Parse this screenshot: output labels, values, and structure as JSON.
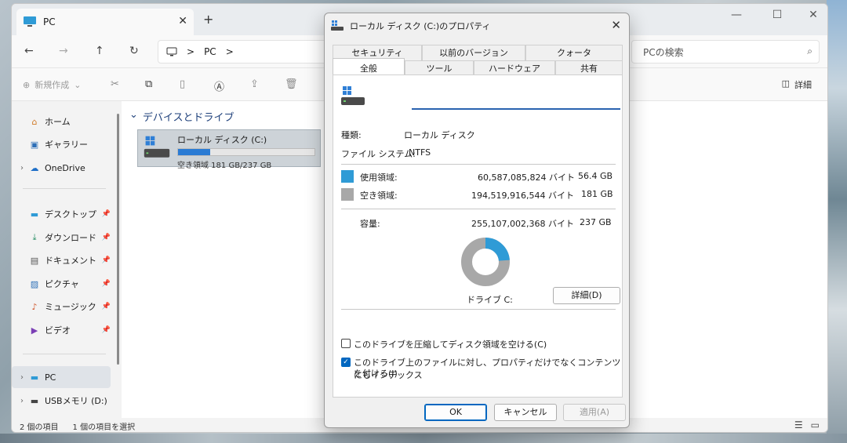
{
  "explorer": {
    "tab_title": "PC",
    "tab_close": "✕",
    "tab_add": "+",
    "controls": {
      "minimize": "—",
      "maximize": "☐",
      "close": "✕"
    },
    "nav": {
      "back": "←",
      "forward": "→",
      "up": "↑",
      "refresh": "↻"
    },
    "address": {
      "segment": "PC",
      "sep": ">"
    },
    "search": {
      "placeholder": "PCの検索"
    },
    "toolbar": {
      "new_label": "新規作成",
      "details_label": "詳細"
    },
    "sidebar": {
      "items": [
        {
          "label": "ホーム",
          "icon": "home-icon"
        },
        {
          "label": "ギャラリー",
          "icon": "gallery-icon"
        },
        {
          "label": "OneDrive",
          "icon": "onedrive-icon"
        },
        {
          "label": "デスクトップ",
          "icon": "desktop-icon"
        },
        {
          "label": "ダウンロード",
          "icon": "download-icon"
        },
        {
          "label": "ドキュメント",
          "icon": "document-icon"
        },
        {
          "label": "ピクチャ",
          "icon": "picture-icon"
        },
        {
          "label": "ミュージック",
          "icon": "music-icon"
        },
        {
          "label": "ビデオ",
          "icon": "video-icon"
        },
        {
          "label": "PC",
          "icon": "pc-icon"
        },
        {
          "label": "USBメモリ (D:)",
          "icon": "usb-drive-icon"
        }
      ]
    },
    "section_title": "デバイスとドライブ",
    "drive": {
      "name": "ローカル ディスク (C:)",
      "free_text": "空き領域 181 GB/237 GB",
      "used_fraction": 0.237
    },
    "status": {
      "count": "2 個の項目",
      "selected": "1 個の項目を選択"
    }
  },
  "dialog": {
    "title": "ローカル ディスク (C:)のプロパティ",
    "close": "✕",
    "tabs_top": [
      "セキュリティ",
      "以前のバージョン",
      "クォータ"
    ],
    "tabs_bottom": [
      "全般",
      "ツール",
      "ハードウェア",
      "共有"
    ],
    "active_tab": "全般",
    "name_value": "",
    "type_label": "種類:",
    "type_value": "ローカル ディスク",
    "fs_label": "ファイル システム:",
    "fs_value": "NTFS",
    "used": {
      "label": "使用領域:",
      "bytes": "60,587,085,824 バイト",
      "size": "56.4 GB",
      "color": "#2f9bd6"
    },
    "free": {
      "label": "空き領域:",
      "bytes": "194,519,916,544 バイト",
      "size": "181 GB",
      "color": "#a8a8a8"
    },
    "capacity": {
      "label": "容量:",
      "bytes": "255,107,002,368 バイト",
      "size": "237 GB"
    },
    "drive_label": "ドライブ C:",
    "details_button": "詳細(D)",
    "compress_label": "このドライブを圧縮してディスク領域を空ける(C)",
    "compress_checked": false,
    "index_label_1": "このドライブ上のファイルに対し、プロパティだけでなくコンテンツにもインデックス",
    "index_label_2": "を付ける(I)",
    "index_checked": true,
    "ok": "OK",
    "cancel": "キャンセル",
    "apply": "適用(A)"
  }
}
